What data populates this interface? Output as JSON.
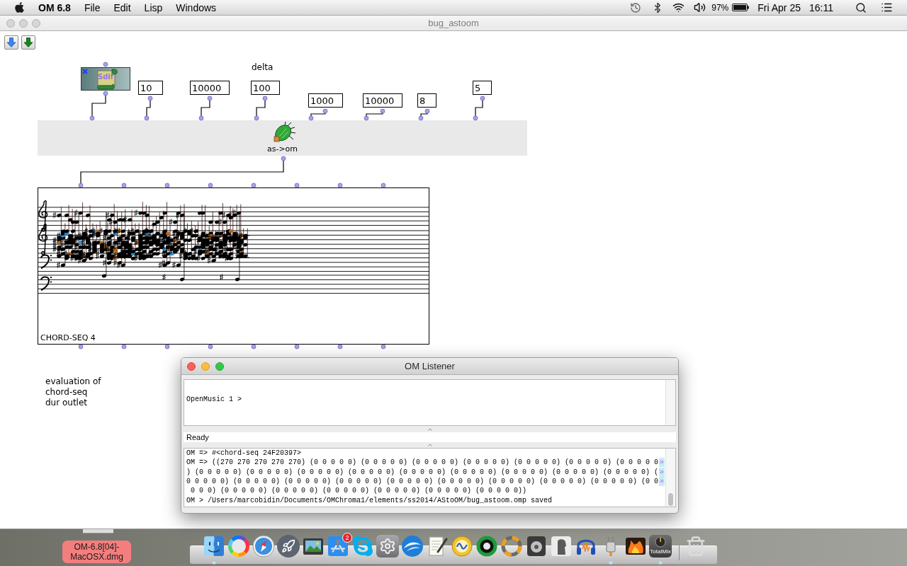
{
  "menu_bar": {
    "app_name": "OM 6.8",
    "menus": [
      "File",
      "Edit",
      "Lisp",
      "Windows"
    ],
    "battery": "97%",
    "date": "Fri Apr 25",
    "time": "16:11"
  },
  "patch_window": {
    "title": "bug_astoom",
    "active": false,
    "patch": {
      "sdif_box": {
        "icon_text": "Sdif",
        "locked": true
      },
      "comments": [
        {
          "lines": [
            "delta"
          ]
        },
        {
          "lines": [
            "evaluation of",
            "chord-seq",
            "dur outlet"
          ]
        }
      ],
      "number_boxes": [
        {
          "value": "10"
        },
        {
          "value": "10000"
        },
        {
          "value": "100"
        },
        {
          "value": "1000"
        },
        {
          "value": "10000"
        },
        {
          "value": "8"
        },
        {
          "value": "5"
        }
      ],
      "function_box": {
        "label": "as->om"
      },
      "score_box": {
        "label": "CHORD-SEQ 4"
      }
    }
  },
  "listener_window": {
    "title": "OM Listener",
    "active": true,
    "prompt": "OpenMusic 1 >",
    "status": "Ready",
    "output": [
      {
        "text": "OM => #<chord-seq 24F20397>"
      },
      {
        "text": "OM => ((270 270 270 270 270) (0 0 0 0 0) (0 0 0 0 0) (0 0 0 0 0) (0 0 0 0 0) (0 0 0 0 0) (0 0 0 0 0) (0 0 0 0 0",
        "continuation": "»"
      },
      {
        "text": ") (0 0 0 0 0) (0 0 0 0 0) (0 0 0 0 0) (0 0 0 0 0) (0 0 0 0 0) (0 0 0 0 0) (0 0 0 0 0) (0 0 0 0 0) (0 0 0 0 0) (",
        "continuation": "»"
      },
      {
        "text": "0 0 0 0 0) (0 0 0 0 0) (0 0 0 0 0) (0 0 0 0 0) (0 0 0 0 0) (0 0 0 0 0) (0 0 0 0 0) (0 0 0 0 0) (0 0 0 0 0) (0 0",
        "continuation": "»"
      },
      {
        "text": " 0 0 0) (0 0 0 0 0) (0 0 0 0 0) (0 0 0 0 0) (0 0 0 0 0) (0 0 0 0 0) (0 0 0 0 0))"
      },
      {
        "text": "OM > /Users/marcobidin/Documents/OMChroma1/elements/ss2014/AStoOM/bug_astoom.omp saved"
      }
    ]
  },
  "desktop": {
    "file_label": "OM-6.8[04]-MacOSX.dmg"
  },
  "dock": {
    "items": [
      {
        "running": true
      },
      {
        "running": false
      },
      {
        "running": false
      },
      {
        "running": false
      },
      {
        "running": false
      },
      {
        "running": false,
        "badge": "2"
      },
      {
        "running": false
      },
      {
        "running": false
      },
      {
        "running": false
      },
      {
        "running": false
      },
      {
        "running": false
      },
      {
        "running": false
      },
      {
        "running": false
      },
      {
        "running": false
      },
      {
        "running": false
      },
      {
        "running": false
      },
      {
        "running": true
      },
      {
        "running": false
      },
      {
        "running": true,
        "caption": "TotalMix"
      },
      {
        "running": false
      }
    ]
  }
}
